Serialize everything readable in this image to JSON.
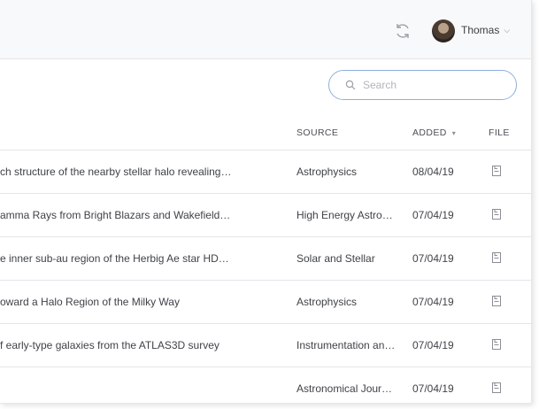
{
  "header": {
    "user_name": "Thomas",
    "refresh_icon": "refresh-icon",
    "chevron_icon": "chevron-down-icon"
  },
  "search": {
    "placeholder": "Search",
    "value": ""
  },
  "table": {
    "columns": {
      "source": "SOURCE",
      "added": "ADDED",
      "file": "FILE"
    },
    "sort_indicator": "▾",
    "rows": [
      {
        "title": "ch structure of the nearby stellar halo revealing…",
        "source": "Astrophysics",
        "added": "08/04/19"
      },
      {
        "title": "amma Rays from Bright Blazars and Wakefield…",
        "source": "High Energy Astro…",
        "added": "07/04/19"
      },
      {
        "title": "e inner sub-au region of the Herbig Ae star HD…",
        "source": "Solar and Stellar",
        "added": "07/04/19"
      },
      {
        "title": "oward a Halo Region of the Milky Way",
        "source": "Astrophysics",
        "added": "07/04/19"
      },
      {
        "title": "f early-type galaxies from the ATLAS3D survey",
        "source": "Instrumentation an…",
        "added": "07/04/19"
      },
      {
        "title": "",
        "source": "Astronomical Jour…",
        "added": "07/04/19"
      }
    ]
  },
  "colors": {
    "topbar_bg": "#f8f9fa",
    "search_border": "#8fb0da",
    "divider": "#e3e5e8",
    "text": "#3f4248"
  }
}
